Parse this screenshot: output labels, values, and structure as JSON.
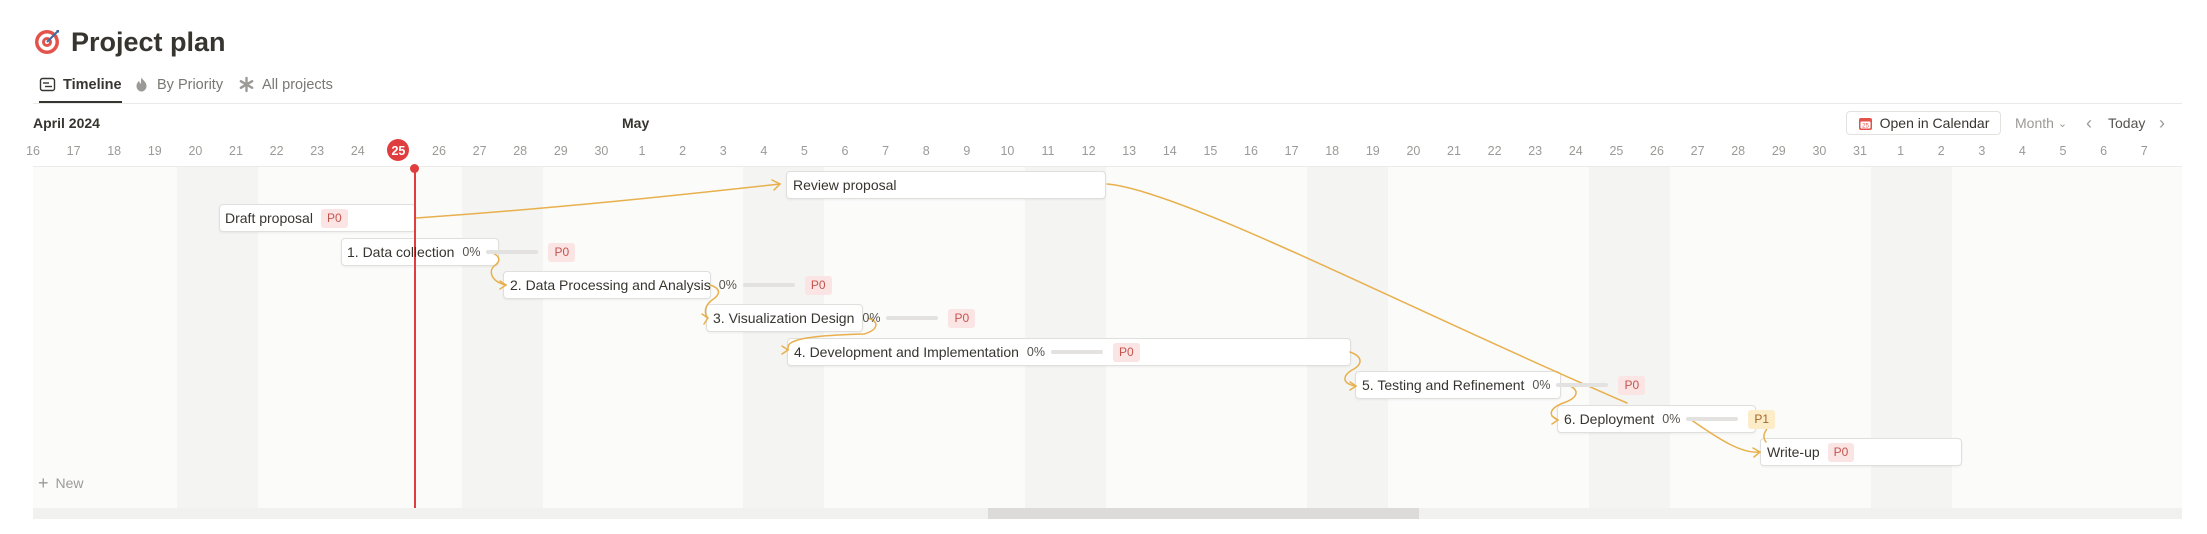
{
  "page": {
    "title": "Project plan",
    "icon": "target-icon"
  },
  "tabs": [
    {
      "label": "Timeline",
      "icon": "timeline-icon",
      "active": true
    },
    {
      "label": "By Priority",
      "icon": "fire-icon",
      "active": false
    },
    {
      "label": "All projects",
      "icon": "asterisk-icon",
      "active": false
    }
  ],
  "header": {
    "month_1": "April 2024",
    "month_2": "May",
    "open_calendar": "Open in Calendar",
    "view": "Month",
    "today": "Today"
  },
  "days": [
    "16",
    "17",
    "18",
    "19",
    "20",
    "21",
    "22",
    "23",
    "24",
    "25",
    "26",
    "27",
    "28",
    "29",
    "30",
    "1",
    "2",
    "3",
    "4",
    "5",
    "6",
    "7",
    "8",
    "9",
    "10",
    "11",
    "12",
    "13",
    "14",
    "15",
    "16",
    "17",
    "18",
    "19",
    "20",
    "21",
    "22",
    "23",
    "24",
    "25",
    "26",
    "27",
    "28",
    "29",
    "30",
    "31",
    "1",
    "2",
    "3",
    "4",
    "5",
    "6",
    "7"
  ],
  "today_index": 9,
  "tasks": [
    {
      "name": "Review proposal",
      "priority": null,
      "progress": null
    },
    {
      "name": "Draft proposal",
      "priority": "P0",
      "progress": null
    },
    {
      "name": "1. Data collection",
      "priority": "P0",
      "progress": "0%"
    },
    {
      "name": "2. Data Processing and Analysis",
      "priority": "P0",
      "progress": "0%"
    },
    {
      "name": "3. Visualization Design",
      "priority": "P0",
      "progress": "0%"
    },
    {
      "name": "4. Development and Implementation",
      "priority": "P0",
      "progress": "0%"
    },
    {
      "name": "5. Testing and Refinement",
      "priority": "P0",
      "progress": "0%"
    },
    {
      "name": "6. Deployment",
      "priority": "P1",
      "progress": "0%"
    },
    {
      "name": "Write-up",
      "priority": "P0",
      "progress": null
    }
  ],
  "new_label": "New",
  "colors": {
    "today": "#e03e3e",
    "dependency": "#e8b04c",
    "p0_bg": "#fbe4e4",
    "p0_text": "#c4554d",
    "p1_bg": "#fdecc8",
    "p1_text": "#a3682a"
  }
}
